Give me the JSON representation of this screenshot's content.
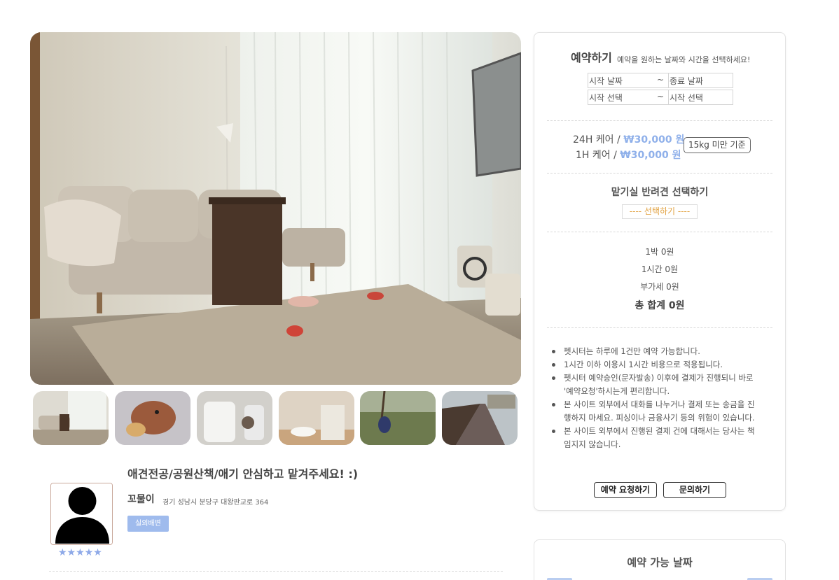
{
  "listing": {
    "title": "애견전공/공원산책/애기 안심하고 맡겨주세요! :)",
    "sitter_name": "꼬물이",
    "address": "경기 성남시 분당구 대왕판교로 364",
    "tag": "실외배변",
    "stars": "★★★★★",
    "rating": 5
  },
  "gallery": {
    "main_photo": "living-room-photo",
    "thumbnails": [
      "living-room",
      "poodle-lying",
      "pet-dryer",
      "food-bowls",
      "dog-walk-grass",
      "boardwalk-path"
    ]
  },
  "booking": {
    "title": "예약하기",
    "subtitle": "예약을 원하는 날짜와 시간을 선택하세요!",
    "start_date": "시작 날짜",
    "end_date": "종료 날짜",
    "start_time": "시작 선택",
    "end_time": "시작 선택",
    "tilde": "~",
    "price_24h_label": "24H 케어 /",
    "price_24h": "₩30,000 원",
    "price_1h_label": "1H 케어 /",
    "price_1h": "₩30,000 원",
    "weight_note": "15kg 미만 기준",
    "pet_title": "맡기실 반려견 선택하기",
    "pet_select": "---- 선택하기 ----",
    "per_night": "1박 0원",
    "per_hour": "1시간 0원",
    "vat": "부가세 0원",
    "total": "총 합계 0원",
    "notices": [
      "펫시터는 하루에 1건만 예약 가능합니다.",
      "1시간 이하 이용시 1시간 비용으로 적용됩니다.",
      "펫시터 예약승인(문자발송) 이후에 결제가 진행되니 바로 '예약요청'하시는게 편리합니다.",
      "본 사이트 외부에서 대화를 나누거나 결제 또는 송금을 진행하지 마세요. 피싱이나 금융사기 등의 위험이 있습니다.",
      "본 사이트 외부에서 진행된 결제 건에 대해서는 당사는 책임지지 않습니다."
    ],
    "request_button": "예약 요청하기",
    "inquiry_button": "문의하기"
  },
  "availability": {
    "title": "예약 가능 날짜"
  },
  "colors": {
    "accent": "#8fb0ea",
    "tag_bg": "#9fbbed",
    "select_text": "#e2a241"
  }
}
